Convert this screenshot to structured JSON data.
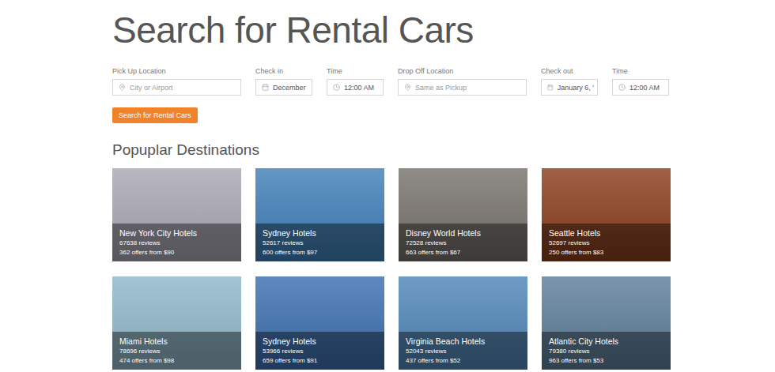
{
  "page": {
    "title": "Search for Rental Cars"
  },
  "form": {
    "fields": [
      {
        "label": "Pick Up Location",
        "kind": "location",
        "value": "City or Airport",
        "placeholder": true
      },
      {
        "label": "Check in",
        "kind": "date",
        "value": "December",
        "placeholder": false
      },
      {
        "label": "Time",
        "kind": "time",
        "value": "12:00 AM",
        "placeholder": false
      },
      {
        "label": "Drop Off Location",
        "kind": "location",
        "value": "Same as Pickup",
        "placeholder": true
      },
      {
        "label": "Check out",
        "kind": "date",
        "value": "January 6, '",
        "placeholder": false
      },
      {
        "label": "Time",
        "kind": "time",
        "value": "12:00 AM",
        "placeholder": false
      }
    ],
    "button": "Search for Rental Cars"
  },
  "section": {
    "title": "Popuplar Destinations"
  },
  "destinations": [
    {
      "name": "New York City Hotels",
      "reviews": "67638 reviews",
      "offers": "362 offers from $90",
      "color": "#a9a7b3"
    },
    {
      "name": "Sydney Hotels",
      "reviews": "52617 reviews",
      "offers": "600 offers from $97",
      "color": "#3f7fb8"
    },
    {
      "name": "Disney World Hotels",
      "reviews": "72528 reviews",
      "offers": "663 offers from $67",
      "color": "#77726c"
    },
    {
      "name": "Seattle Hotels",
      "reviews": "52697 reviews",
      "offers": "250 offers from $83",
      "color": "#8a3d1c"
    },
    {
      "name": "Miami Hotels",
      "reviews": "78696 reviews",
      "offers": "474 offers from $98",
      "color": "#8fb7c9"
    },
    {
      "name": "Sydney Hotels",
      "reviews": "53966 reviews",
      "offers": "659 offers from $91",
      "color": "#3c6fb0"
    },
    {
      "name": "Virginia Beach Hotels",
      "reviews": "52043 reviews",
      "offers": "437 offers from $52",
      "color": "#4f86b8"
    },
    {
      "name": "Atlantic City Hotels",
      "reviews": "79380 reviews",
      "offers": "963 offers from $53",
      "color": "#5d7e9a"
    }
  ]
}
